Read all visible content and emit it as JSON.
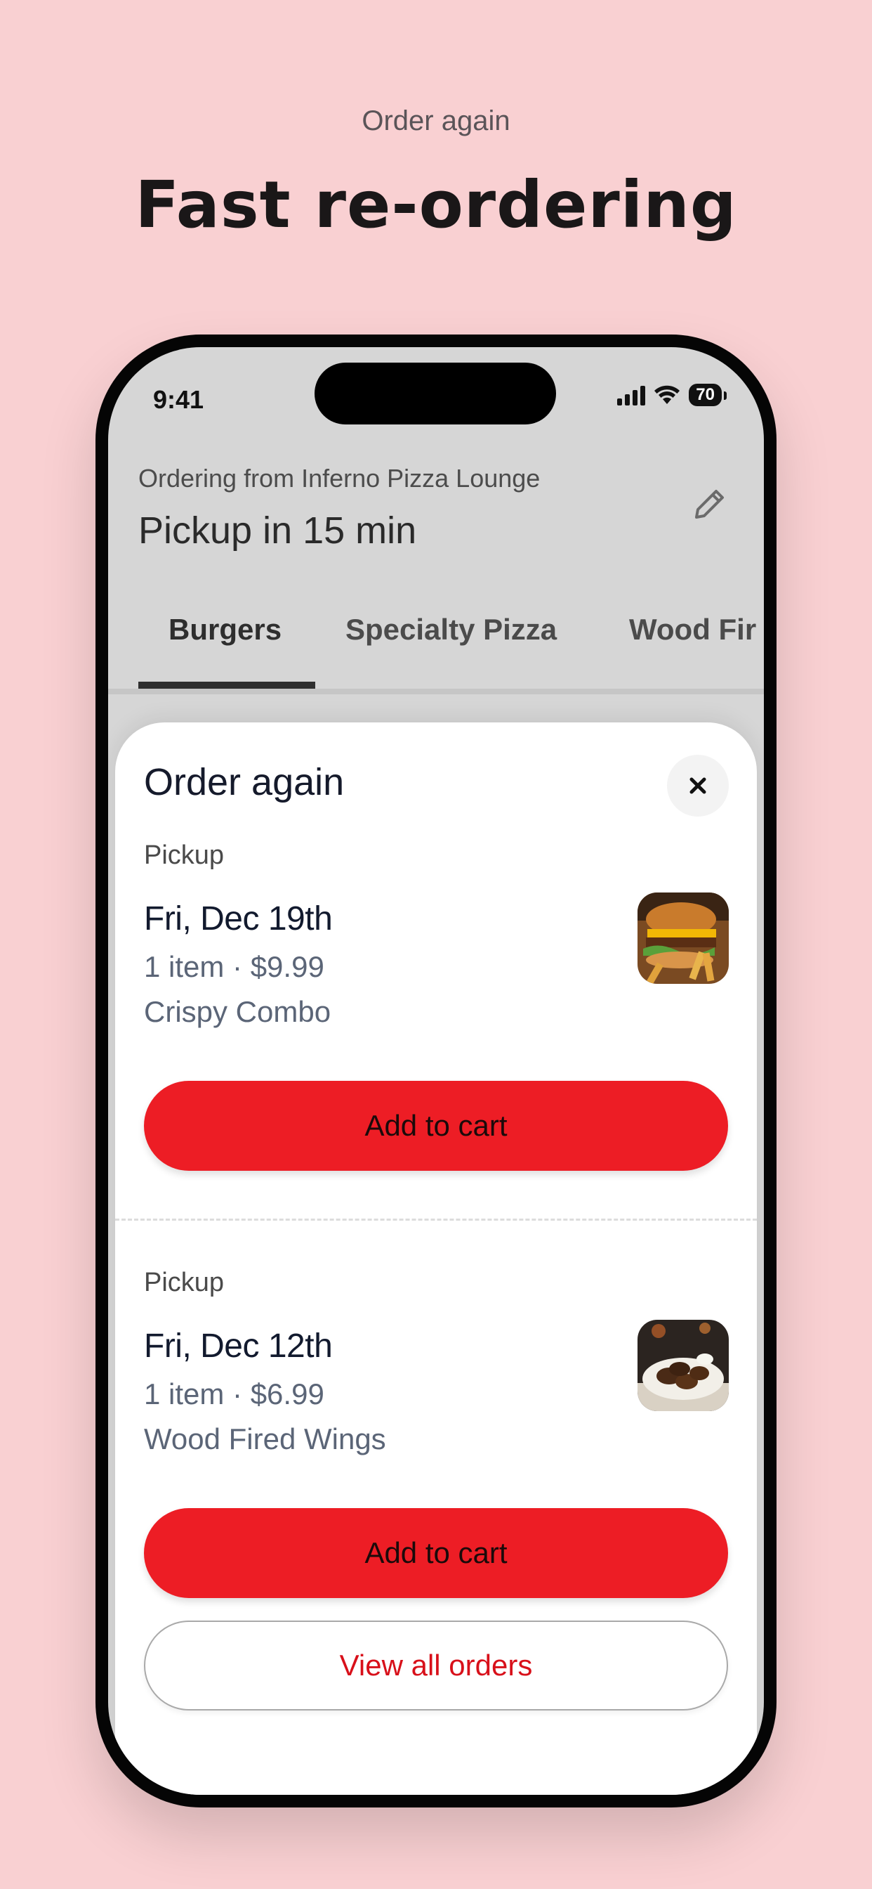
{
  "promo": {
    "kicker": "Order again",
    "title": "Fast re-ordering"
  },
  "status_bar": {
    "time": "9:41",
    "battery": "70",
    "icons": [
      "cellular-signal-icon",
      "wifi-icon",
      "battery-icon"
    ]
  },
  "header": {
    "ordering_from": "Ordering from Inferno Pizza Lounge",
    "pickup": "Pickup in 15 min",
    "edit_icon": "pencil-icon"
  },
  "tabs": [
    {
      "label": "Burgers",
      "active": true
    },
    {
      "label": "Specialty Pizza",
      "active": false
    },
    {
      "label": "Wood Fir",
      "active": false
    }
  ],
  "sheet": {
    "title": "Order again",
    "close_icon": "close-icon",
    "orders": [
      {
        "type": "Pickup",
        "date": "Fri, Dec 19th",
        "meta": "1 item · $9.99",
        "name": "Crispy Combo",
        "image_icon": "burger-photo",
        "button": "Add to cart"
      },
      {
        "type": "Pickup",
        "date": "Fri, Dec 12th",
        "meta": "1 item · $6.99",
        "name": "Wood Fired Wings",
        "image_icon": "wings-photo",
        "button": "Add to cart"
      }
    ],
    "view_all": "View all orders"
  },
  "colors": {
    "background": "#f9d0d2",
    "accent_red": "#ed1d25",
    "link_red": "#d8101a",
    "text_dark": "#121a2e"
  }
}
